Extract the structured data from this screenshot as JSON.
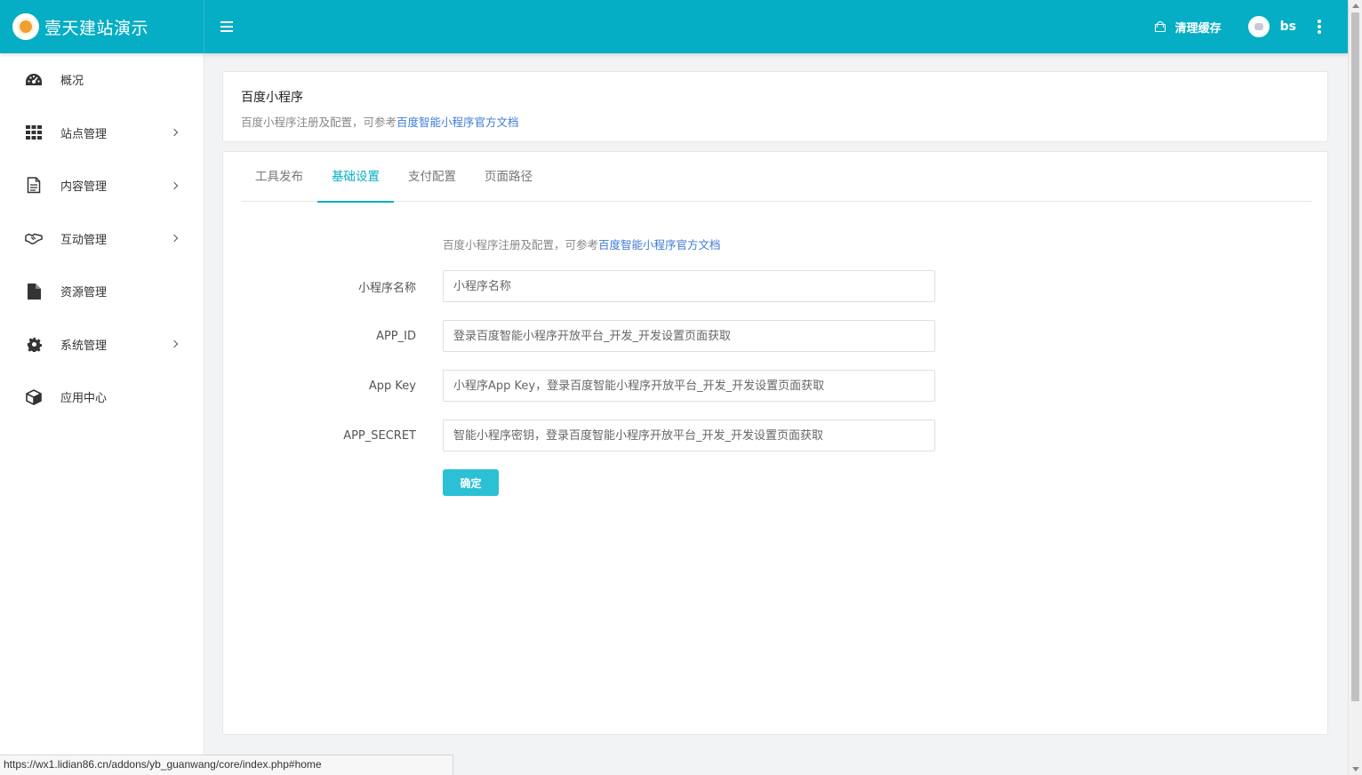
{
  "brand": {
    "title": "壹天建站演示",
    "logo_icon": "cartoon-cow-logo"
  },
  "topbar": {
    "menu_icon": "hamburger-icon",
    "clear_cache_label": "清理缓存",
    "clear_cache_icon": "basket-icon",
    "user_name": "bs",
    "more_icon": "vertical-dots-icon",
    "background": "#05aec4"
  },
  "sidebar": {
    "items": [
      {
        "label": "概况",
        "icon": "dashboard-icon",
        "has_children": false
      },
      {
        "label": "站点管理",
        "icon": "grid-icon",
        "has_children": true
      },
      {
        "label": "内容管理",
        "icon": "document-icon",
        "has_children": true
      },
      {
        "label": "互动管理",
        "icon": "handshake-icon",
        "has_children": true
      },
      {
        "label": "资源管理",
        "icon": "file-icon",
        "has_children": false
      },
      {
        "label": "系统管理",
        "icon": "gear-icon",
        "has_children": true
      },
      {
        "label": "应用中心",
        "icon": "cube-icon",
        "has_children": false
      }
    ]
  },
  "header_card": {
    "title": "百度小程序",
    "desc_prefix": "百度小程序注册及配置，可参考",
    "desc_link": "百度智能小程序官方文档"
  },
  "tabs": [
    {
      "label": "工具发布",
      "active": false
    },
    {
      "label": "基础设置",
      "active": true
    },
    {
      "label": "支付配置",
      "active": false
    },
    {
      "label": "页面路径",
      "active": false
    }
  ],
  "form": {
    "note_prefix": "百度小程序注册及配置，可参考",
    "note_link": "百度智能小程序官方文档",
    "fields": [
      {
        "label": "小程序名称",
        "value": "",
        "placeholder": "小程序名称"
      },
      {
        "label": "APP_ID",
        "value": "",
        "placeholder": "登录百度智能小程序开放平台_开发_开发设置页面获取"
      },
      {
        "label": "App Key",
        "value": "",
        "placeholder": "小程序App Key，登录百度智能小程序开放平台_开发_开发设置页面获取"
      },
      {
        "label": "APP_SECRET",
        "value": "",
        "placeholder": "智能小程序密钥，登录百度智能小程序开放平台_开发_开发设置页面获取"
      }
    ],
    "submit_label": "确定"
  },
  "status_bar": {
    "url": "https://wx1.lidian86.cn/addons/yb_guanwang/core/index.php#home"
  },
  "colors": {
    "accent": "#05aec4",
    "button": "#2bc0d6",
    "link": "#3e7bd6"
  }
}
